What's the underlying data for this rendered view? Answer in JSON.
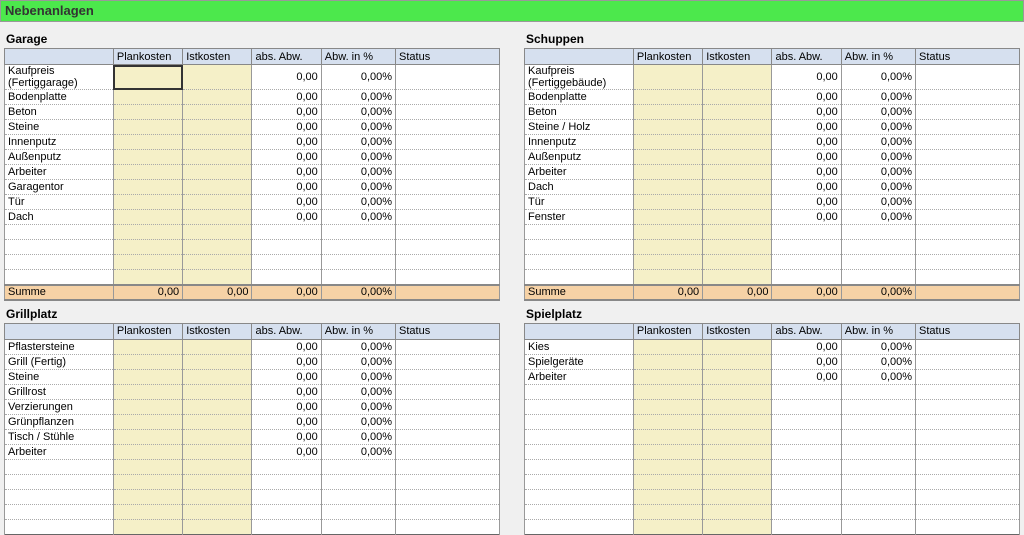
{
  "title": "Nebenanlagen",
  "headers": {
    "label": "",
    "plankosten": "Plankosten",
    "istkosten": "Istkosten",
    "abs_abw": "abs. Abw.",
    "abw_pct": "Abw. in %",
    "status": "Status"
  },
  "sum_label": "Summe",
  "zero": "0,00",
  "zero_pct": "0,00%",
  "tables": {
    "garage": {
      "title": "Garage",
      "items": [
        "Kaufpreis (Fertiggarage)",
        "Bodenplatte",
        "Beton",
        "Steine",
        "Innenputz",
        "Außenputz",
        "Arbeiter",
        "Garagentor",
        "Tür",
        "Dach"
      ],
      "blank_rows": 4,
      "sum": {
        "plan": "0,00",
        "ist": "0,00",
        "abw": "0,00",
        "pct": "0,00%"
      }
    },
    "schuppen": {
      "title": "Schuppen",
      "items": [
        "Kaufpreis (Fertiggebäude)",
        "Bodenplatte",
        "Beton",
        "Steine / Holz",
        "Innenputz",
        "Außenputz",
        "Arbeiter",
        "Dach",
        "Tür",
        "Fenster"
      ],
      "blank_rows": 4,
      "sum": {
        "plan": "0,00",
        "ist": "0,00",
        "abw": "0,00",
        "pct": "0,00%"
      }
    },
    "grillplatz": {
      "title": "Grillplatz",
      "items": [
        "Pflastersteine",
        "Grill (Fertig)",
        "Steine",
        "Grillrost",
        "Verzierungen",
        "Grünpflanzen",
        "Tisch / Stühle",
        "Arbeiter"
      ],
      "blank_rows": 5,
      "sum": null
    },
    "spielplatz": {
      "title": "Spielplatz",
      "items": [
        "Kies",
        "Spielgeräte",
        "Arbeiter"
      ],
      "blank_rows": 10,
      "sum": null
    }
  }
}
